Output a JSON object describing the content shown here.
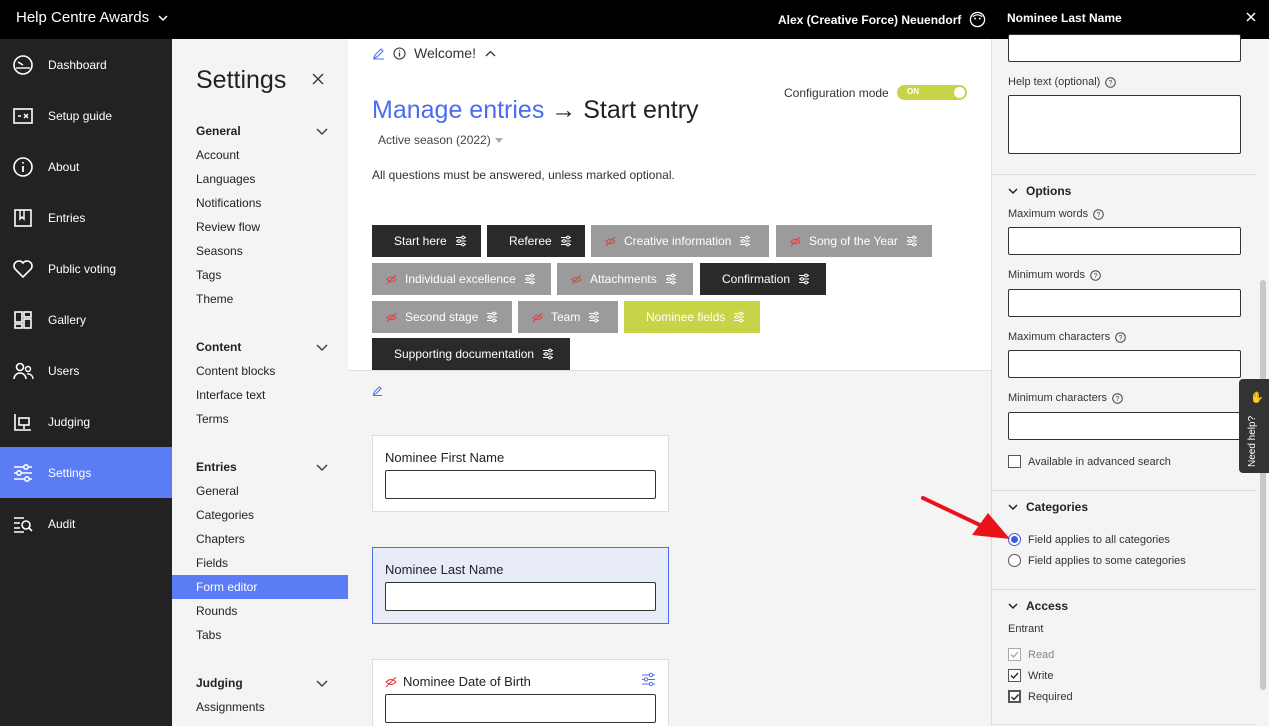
{
  "topbar": {
    "brand": "Help Centre Awards",
    "user": "Alex (Creative Force) Neuendorf",
    "panel_title": "Nominee Last Name"
  },
  "nav": {
    "items": [
      {
        "label": "Dashboard",
        "icon": "dashboard-icon"
      },
      {
        "label": "Setup guide",
        "icon": "setup-guide-icon"
      },
      {
        "label": "About",
        "icon": "info-icon"
      },
      {
        "label": "Entries",
        "icon": "entries-icon"
      },
      {
        "label": "Public voting",
        "icon": "heart-icon"
      },
      {
        "label": "Gallery",
        "icon": "gallery-icon"
      },
      {
        "label": "Users",
        "icon": "users-icon"
      },
      {
        "label": "Judging",
        "icon": "judging-icon"
      },
      {
        "label": "Settings",
        "icon": "settings-sliders-icon"
      },
      {
        "label": "Audit",
        "icon": "audit-icon"
      }
    ],
    "active": "Settings"
  },
  "settings": {
    "title": "Settings",
    "groups": {
      "general": {
        "title": "General",
        "links": [
          "Account",
          "Languages",
          "Notifications",
          "Review flow",
          "Seasons",
          "Tags",
          "Theme"
        ]
      },
      "content": {
        "title": "Content",
        "links": [
          "Content blocks",
          "Interface text",
          "Terms"
        ]
      },
      "entries": {
        "title": "Entries",
        "links": [
          "General",
          "Categories",
          "Chapters",
          "Fields",
          "Form editor",
          "Rounds",
          "Tabs"
        ]
      },
      "judging": {
        "title": "Judging",
        "links": [
          "Assignments"
        ]
      }
    },
    "active_link": "Form editor"
  },
  "main": {
    "welcome": "Welcome!",
    "crumb_link": "Manage entries",
    "crumb_arrow": "→",
    "crumb_current": "Start entry",
    "season": "Active season (2022)",
    "notice": "All questions must be answered, unless marked optional.",
    "config_label": "Configuration mode",
    "toggle_text": "ON",
    "tabs": [
      {
        "label": "Start here",
        "style": "dark",
        "hidden": false
      },
      {
        "label": "Referee",
        "style": "dark",
        "hidden": false
      },
      {
        "label": "Creative information",
        "style": "grey",
        "hidden": true
      },
      {
        "label": "Song of the Year",
        "style": "grey",
        "hidden": true
      },
      {
        "label": "Individual excellence",
        "style": "grey",
        "hidden": true
      },
      {
        "label": "Attachments",
        "style": "grey",
        "hidden": true
      },
      {
        "label": "Confirmation",
        "style": "dark",
        "hidden": false
      },
      {
        "label": "Second stage",
        "style": "grey",
        "hidden": true
      },
      {
        "label": "Team",
        "style": "grey",
        "hidden": true
      },
      {
        "label": "Nominee fields",
        "style": "green",
        "hidden": false
      },
      {
        "label": "Supporting documentation",
        "style": "dark",
        "hidden": false
      }
    ],
    "fields": [
      {
        "label": "Nominee First Name",
        "value": ""
      },
      {
        "label": "Nominee Last Name",
        "value": "",
        "selected": true
      },
      {
        "label": "Nominee Date of Birth",
        "value": "",
        "hidden": true
      }
    ]
  },
  "panel": {
    "help_text_label": "Help text (optional)",
    "options": {
      "title": "Options",
      "max_words": "Maximum words",
      "min_words": "Minimum words",
      "max_chars": "Maximum characters",
      "min_chars": "Minimum characters",
      "advanced_search": "Available in advanced search"
    },
    "categories": {
      "title": "Categories",
      "all": "Field applies to all categories",
      "some": "Field applies to some categories",
      "selected": "all"
    },
    "access": {
      "title": "Access",
      "role": "Entrant",
      "read": "Read",
      "write": "Write",
      "required": "Required"
    },
    "need_help": "Need help?"
  },
  "colors": {
    "accent": "#5b7cf5",
    "link": "#4a6cf0",
    "toggle": "#c8d447",
    "dark_tab": "#2a2a2a",
    "grey_tab": "#9b9b9b",
    "arrow": "#e8141b"
  }
}
